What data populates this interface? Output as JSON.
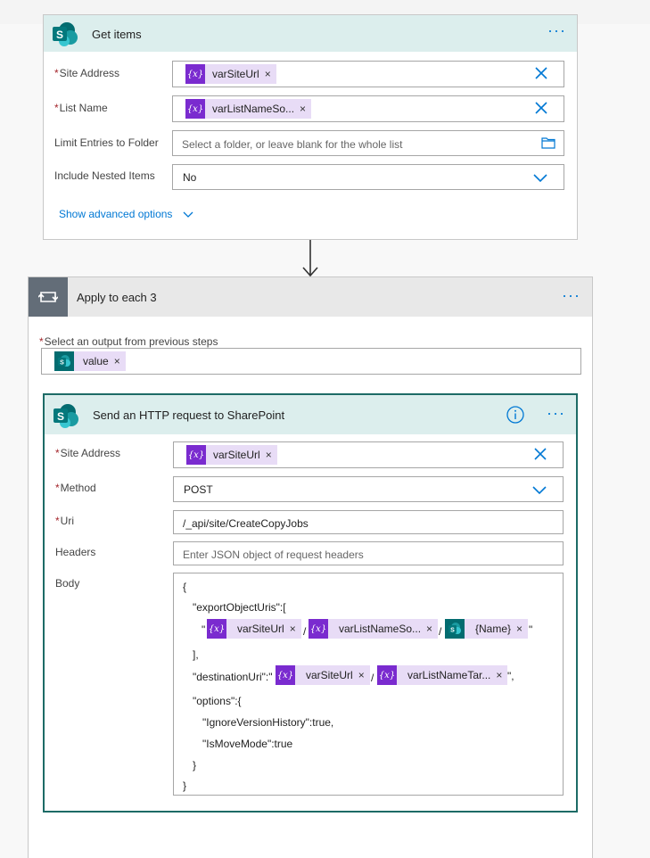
{
  "get_items": {
    "title": "Get items",
    "menu": "···",
    "site_address": {
      "label": "Site Address",
      "token": "varSiteUrl"
    },
    "list_name": {
      "label": "List Name",
      "token": "varListNameSo..."
    },
    "limit_folder": {
      "label": "Limit Entries to Folder",
      "placeholder": "Select a folder, or leave blank for the whole list"
    },
    "nested_items": {
      "label": "Include Nested Items",
      "value": "No"
    },
    "advanced_link": "Show advanced options"
  },
  "apply_each": {
    "title": "Apply to each 3",
    "menu": "···",
    "select_label": "Select an output from previous steps",
    "output_token": "value"
  },
  "http_request": {
    "title": "Send an HTTP request to SharePoint",
    "menu": "···",
    "site_address": {
      "label": "Site Address",
      "token": "varSiteUrl"
    },
    "method": {
      "label": "Method",
      "value": "POST"
    },
    "uri": {
      "label": "Uri",
      "value": "/_api/site/CreateCopyJobs"
    },
    "headers": {
      "label": "Headers",
      "placeholder": "Enter JSON object of request headers"
    },
    "body": {
      "label": "Body",
      "line_open": "{",
      "export_key": "\"exportObjectUris\":[",
      "quote_open": "\"",
      "token_site": "varSiteUrl",
      "slash": "/",
      "token_list_source": "varListNameSo...",
      "token_name": "{Name}",
      "quote_close": "\"",
      "array_close": "],",
      "dest_key": "\"destinationUri\":\"",
      "token_list_target": "varListNameTar...",
      "dest_close": "\",",
      "options_key": "\"options\":{",
      "ignore_version": "\"IgnoreVersionHistory\":true,",
      "is_move": "\"IsMoveMode\":true",
      "options_close": "}",
      "line_close": "}"
    }
  },
  "required_mark": "*",
  "remove_mark": "×",
  "colors": {
    "accent": "#0078d4",
    "sharepoint_header": "#dceeed",
    "variable_token": "#7a2bcf",
    "token_bg": "#e8dcf6",
    "loop_icon_bg": "#636d78",
    "http_border": "#1d6b66"
  }
}
